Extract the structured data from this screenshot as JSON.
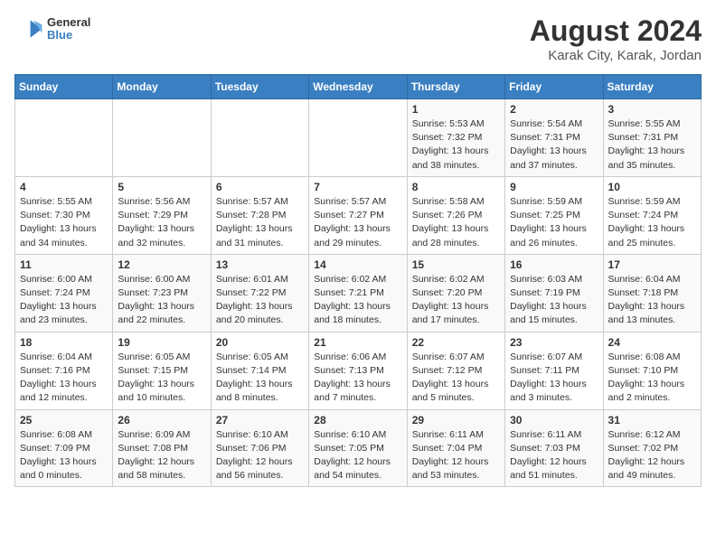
{
  "header": {
    "logo_general": "General",
    "logo_blue": "Blue",
    "title": "August 2024",
    "subtitle": "Karak City, Karak, Jordan"
  },
  "days_of_week": [
    "Sunday",
    "Monday",
    "Tuesday",
    "Wednesday",
    "Thursday",
    "Friday",
    "Saturday"
  ],
  "weeks": [
    [
      {
        "num": "",
        "info": ""
      },
      {
        "num": "",
        "info": ""
      },
      {
        "num": "",
        "info": ""
      },
      {
        "num": "",
        "info": ""
      },
      {
        "num": "1",
        "info": "Sunrise: 5:53 AM\nSunset: 7:32 PM\nDaylight: 13 hours\nand 38 minutes."
      },
      {
        "num": "2",
        "info": "Sunrise: 5:54 AM\nSunset: 7:31 PM\nDaylight: 13 hours\nand 37 minutes."
      },
      {
        "num": "3",
        "info": "Sunrise: 5:55 AM\nSunset: 7:31 PM\nDaylight: 13 hours\nand 35 minutes."
      }
    ],
    [
      {
        "num": "4",
        "info": "Sunrise: 5:55 AM\nSunset: 7:30 PM\nDaylight: 13 hours\nand 34 minutes."
      },
      {
        "num": "5",
        "info": "Sunrise: 5:56 AM\nSunset: 7:29 PM\nDaylight: 13 hours\nand 32 minutes."
      },
      {
        "num": "6",
        "info": "Sunrise: 5:57 AM\nSunset: 7:28 PM\nDaylight: 13 hours\nand 31 minutes."
      },
      {
        "num": "7",
        "info": "Sunrise: 5:57 AM\nSunset: 7:27 PM\nDaylight: 13 hours\nand 29 minutes."
      },
      {
        "num": "8",
        "info": "Sunrise: 5:58 AM\nSunset: 7:26 PM\nDaylight: 13 hours\nand 28 minutes."
      },
      {
        "num": "9",
        "info": "Sunrise: 5:59 AM\nSunset: 7:25 PM\nDaylight: 13 hours\nand 26 minutes."
      },
      {
        "num": "10",
        "info": "Sunrise: 5:59 AM\nSunset: 7:24 PM\nDaylight: 13 hours\nand 25 minutes."
      }
    ],
    [
      {
        "num": "11",
        "info": "Sunrise: 6:00 AM\nSunset: 7:24 PM\nDaylight: 13 hours\nand 23 minutes."
      },
      {
        "num": "12",
        "info": "Sunrise: 6:00 AM\nSunset: 7:23 PM\nDaylight: 13 hours\nand 22 minutes."
      },
      {
        "num": "13",
        "info": "Sunrise: 6:01 AM\nSunset: 7:22 PM\nDaylight: 13 hours\nand 20 minutes."
      },
      {
        "num": "14",
        "info": "Sunrise: 6:02 AM\nSunset: 7:21 PM\nDaylight: 13 hours\nand 18 minutes."
      },
      {
        "num": "15",
        "info": "Sunrise: 6:02 AM\nSunset: 7:20 PM\nDaylight: 13 hours\nand 17 minutes."
      },
      {
        "num": "16",
        "info": "Sunrise: 6:03 AM\nSunset: 7:19 PM\nDaylight: 13 hours\nand 15 minutes."
      },
      {
        "num": "17",
        "info": "Sunrise: 6:04 AM\nSunset: 7:18 PM\nDaylight: 13 hours\nand 13 minutes."
      }
    ],
    [
      {
        "num": "18",
        "info": "Sunrise: 6:04 AM\nSunset: 7:16 PM\nDaylight: 13 hours\nand 12 minutes."
      },
      {
        "num": "19",
        "info": "Sunrise: 6:05 AM\nSunset: 7:15 PM\nDaylight: 13 hours\nand 10 minutes."
      },
      {
        "num": "20",
        "info": "Sunrise: 6:05 AM\nSunset: 7:14 PM\nDaylight: 13 hours\nand 8 minutes."
      },
      {
        "num": "21",
        "info": "Sunrise: 6:06 AM\nSunset: 7:13 PM\nDaylight: 13 hours\nand 7 minutes."
      },
      {
        "num": "22",
        "info": "Sunrise: 6:07 AM\nSunset: 7:12 PM\nDaylight: 13 hours\nand 5 minutes."
      },
      {
        "num": "23",
        "info": "Sunrise: 6:07 AM\nSunset: 7:11 PM\nDaylight: 13 hours\nand 3 minutes."
      },
      {
        "num": "24",
        "info": "Sunrise: 6:08 AM\nSunset: 7:10 PM\nDaylight: 13 hours\nand 2 minutes."
      }
    ],
    [
      {
        "num": "25",
        "info": "Sunrise: 6:08 AM\nSunset: 7:09 PM\nDaylight: 13 hours\nand 0 minutes."
      },
      {
        "num": "26",
        "info": "Sunrise: 6:09 AM\nSunset: 7:08 PM\nDaylight: 12 hours\nand 58 minutes."
      },
      {
        "num": "27",
        "info": "Sunrise: 6:10 AM\nSunset: 7:06 PM\nDaylight: 12 hours\nand 56 minutes."
      },
      {
        "num": "28",
        "info": "Sunrise: 6:10 AM\nSunset: 7:05 PM\nDaylight: 12 hours\nand 54 minutes."
      },
      {
        "num": "29",
        "info": "Sunrise: 6:11 AM\nSunset: 7:04 PM\nDaylight: 12 hours\nand 53 minutes."
      },
      {
        "num": "30",
        "info": "Sunrise: 6:11 AM\nSunset: 7:03 PM\nDaylight: 12 hours\nand 51 minutes."
      },
      {
        "num": "31",
        "info": "Sunrise: 6:12 AM\nSunset: 7:02 PM\nDaylight: 12 hours\nand 49 minutes."
      }
    ]
  ]
}
